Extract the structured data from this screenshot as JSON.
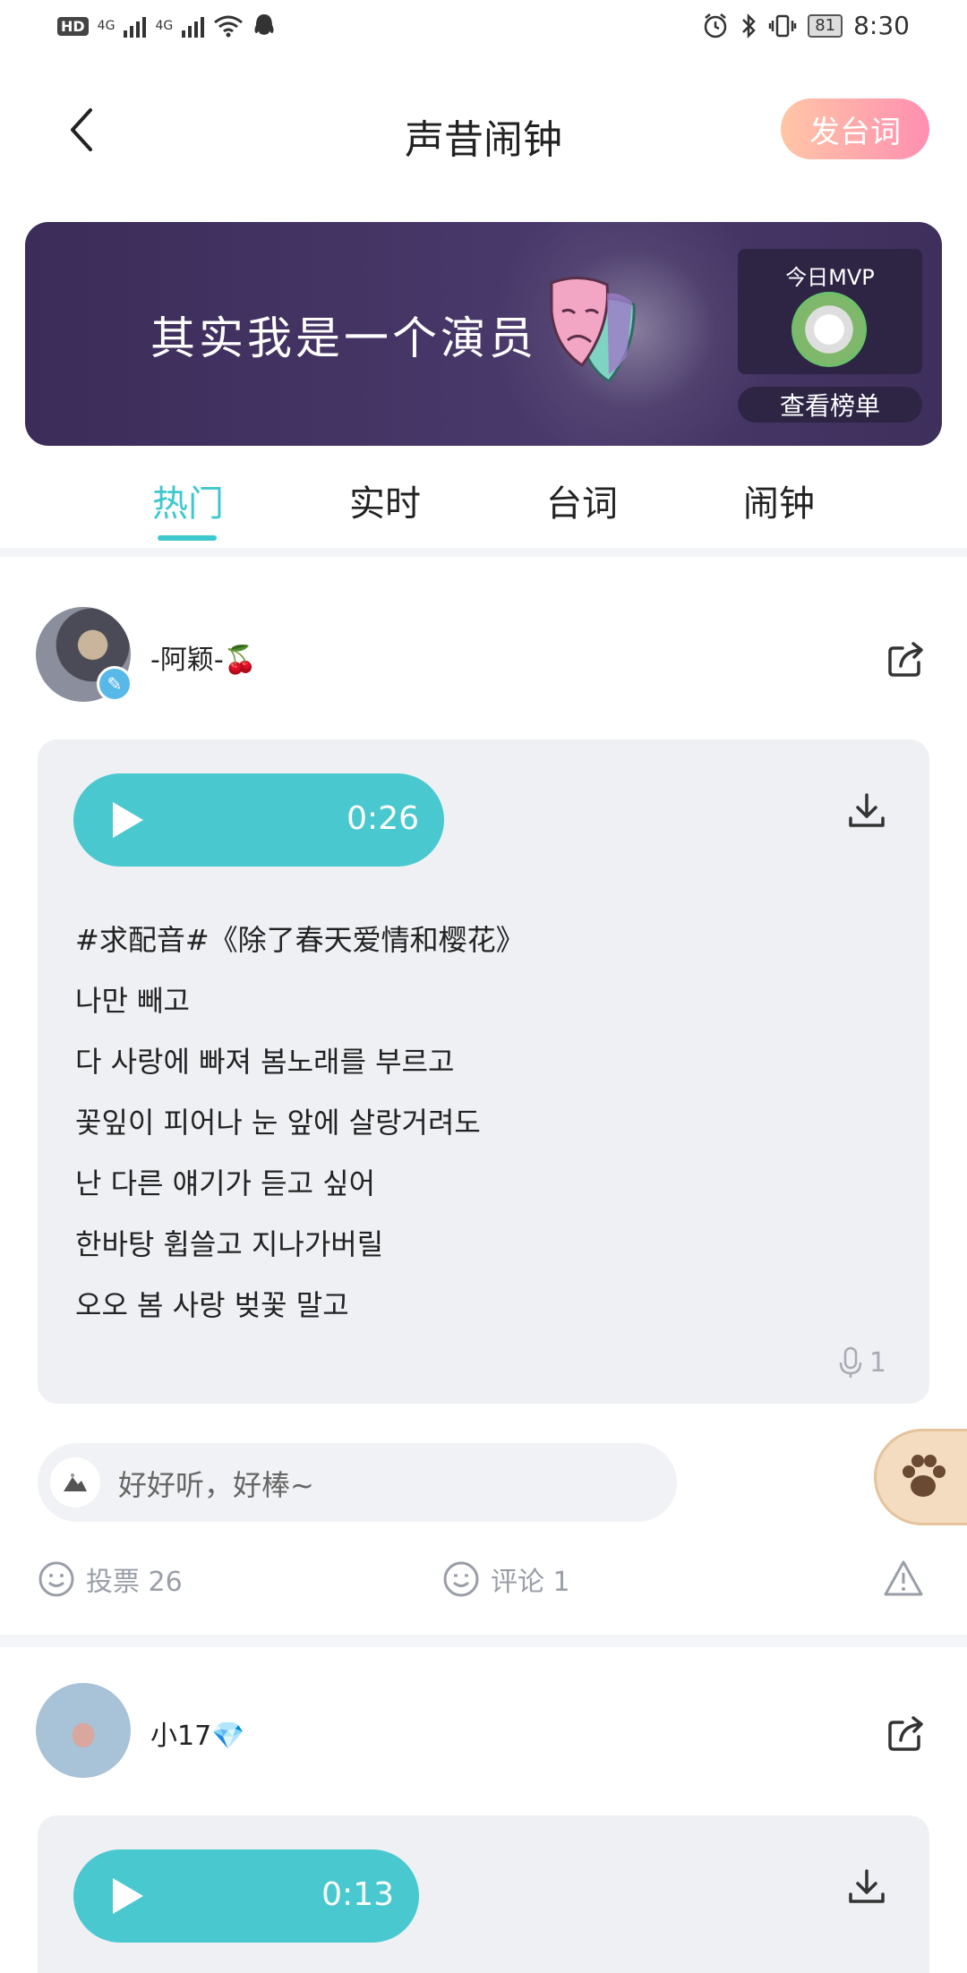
{
  "status_bar": {
    "left_badge": "HD",
    "network_1": "4G",
    "network_2": "4G",
    "battery": "81",
    "time": "8:30"
  },
  "header": {
    "title": "声昔闹钟",
    "post_button": "发台词"
  },
  "banner": {
    "headline": "其实我是一个演员",
    "mvp_label": "今日MVP",
    "leaderboard_button": "查看榜单"
  },
  "tabs": [
    {
      "label": "热门",
      "active": true
    },
    {
      "label": "实时",
      "active": false
    },
    {
      "label": "台词",
      "active": false
    },
    {
      "label": "闹钟",
      "active": false
    }
  ],
  "posts": [
    {
      "username": "-阿颖-🍒",
      "duration": "0:26",
      "lyrics": [
        "#求配音#《除了春天爱情和樱花》",
        "나만 빼고",
        "다 사랑에 빠져 봄노래를 부르고",
        "꽃잎이 피어나 눈 앞에 살랑거려도",
        "난 다른 얘기가 듣고 싶어",
        "한바탕 휩쓸고 지나가버릴",
        "오오 봄 사랑 벚꽃 말고"
      ],
      "mic_count": "1",
      "comment": "好好听，好棒~",
      "vote_label": "投票 26",
      "comment_label": "评论 1"
    },
    {
      "username": "小17💎",
      "duration": "0:13"
    }
  ],
  "colors": {
    "accent": "#3ec8cd",
    "play_pill": "#49c9cf",
    "post_button_from": "#ffc6a6",
    "post_button_to": "#ff8fb1",
    "banner_bg": "#3f305e"
  }
}
